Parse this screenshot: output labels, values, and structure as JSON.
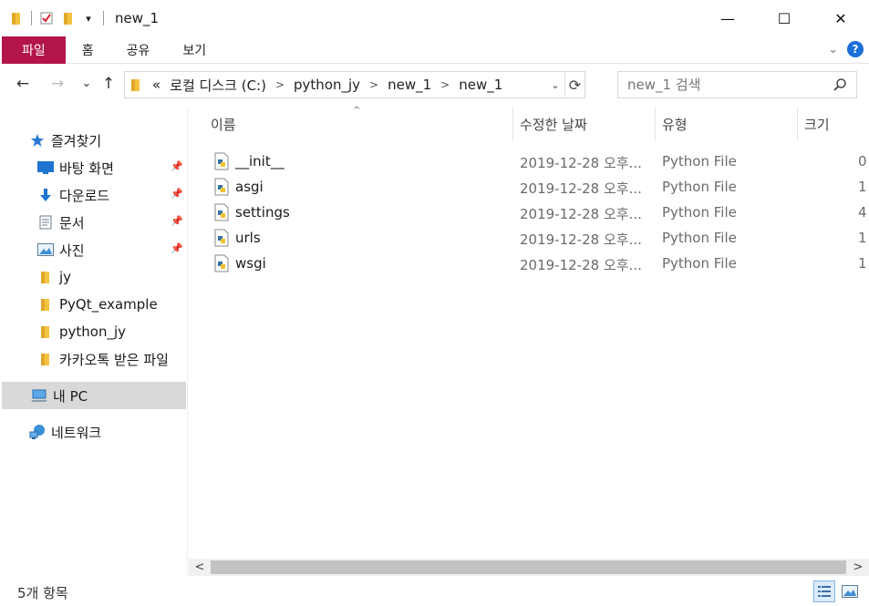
{
  "window": {
    "title": "new_1",
    "minimize": "—",
    "maximize": "☐",
    "close": "✕"
  },
  "ribbon": {
    "tabs": [
      "파일",
      "홈",
      "공유",
      "보기"
    ],
    "help": "?"
  },
  "nav": {
    "back": "←",
    "forward": "→",
    "recent": "⌄",
    "up": "↑"
  },
  "address": {
    "overflow": "«",
    "crumbs": [
      "로컬 디스크 (C:)",
      "python_jy",
      "new_1",
      "new_1"
    ]
  },
  "search": {
    "placeholder": "new_1 검색"
  },
  "sidebar": {
    "quick_access": "즐겨찾기",
    "items": [
      {
        "label": "바탕 화면",
        "pinned": true
      },
      {
        "label": "다운로드",
        "pinned": true
      },
      {
        "label": "문서",
        "pinned": true
      },
      {
        "label": "사진",
        "pinned": true
      },
      {
        "label": "jy",
        "pinned": false
      },
      {
        "label": "PyQt_example",
        "pinned": false
      },
      {
        "label": "python_jy",
        "pinned": false
      },
      {
        "label": "카카오톡 받은 파일",
        "pinned": false
      }
    ],
    "this_pc": "내 PC",
    "network": "네트워크"
  },
  "columns": {
    "name": "이름",
    "date": "수정한 날짜",
    "type": "유형",
    "size": "크기"
  },
  "files": [
    {
      "name": "__init__",
      "date": "2019-12-28 오후...",
      "type": "Python File",
      "size": "0"
    },
    {
      "name": "asgi",
      "date": "2019-12-28 오후...",
      "type": "Python File",
      "size": "1"
    },
    {
      "name": "settings",
      "date": "2019-12-28 오후...",
      "type": "Python File",
      "size": "4"
    },
    {
      "name": "urls",
      "date": "2019-12-28 오후...",
      "type": "Python File",
      "size": "1"
    },
    {
      "name": "wsgi",
      "date": "2019-12-28 오후...",
      "type": "Python File",
      "size": "1"
    }
  ],
  "status": {
    "item_count": "5개 항목"
  },
  "colors": {
    "file_tab": "#b3154a",
    "folder": "#f5c342",
    "accent": "#1a6fd8",
    "selected": "#d9d9d9"
  }
}
